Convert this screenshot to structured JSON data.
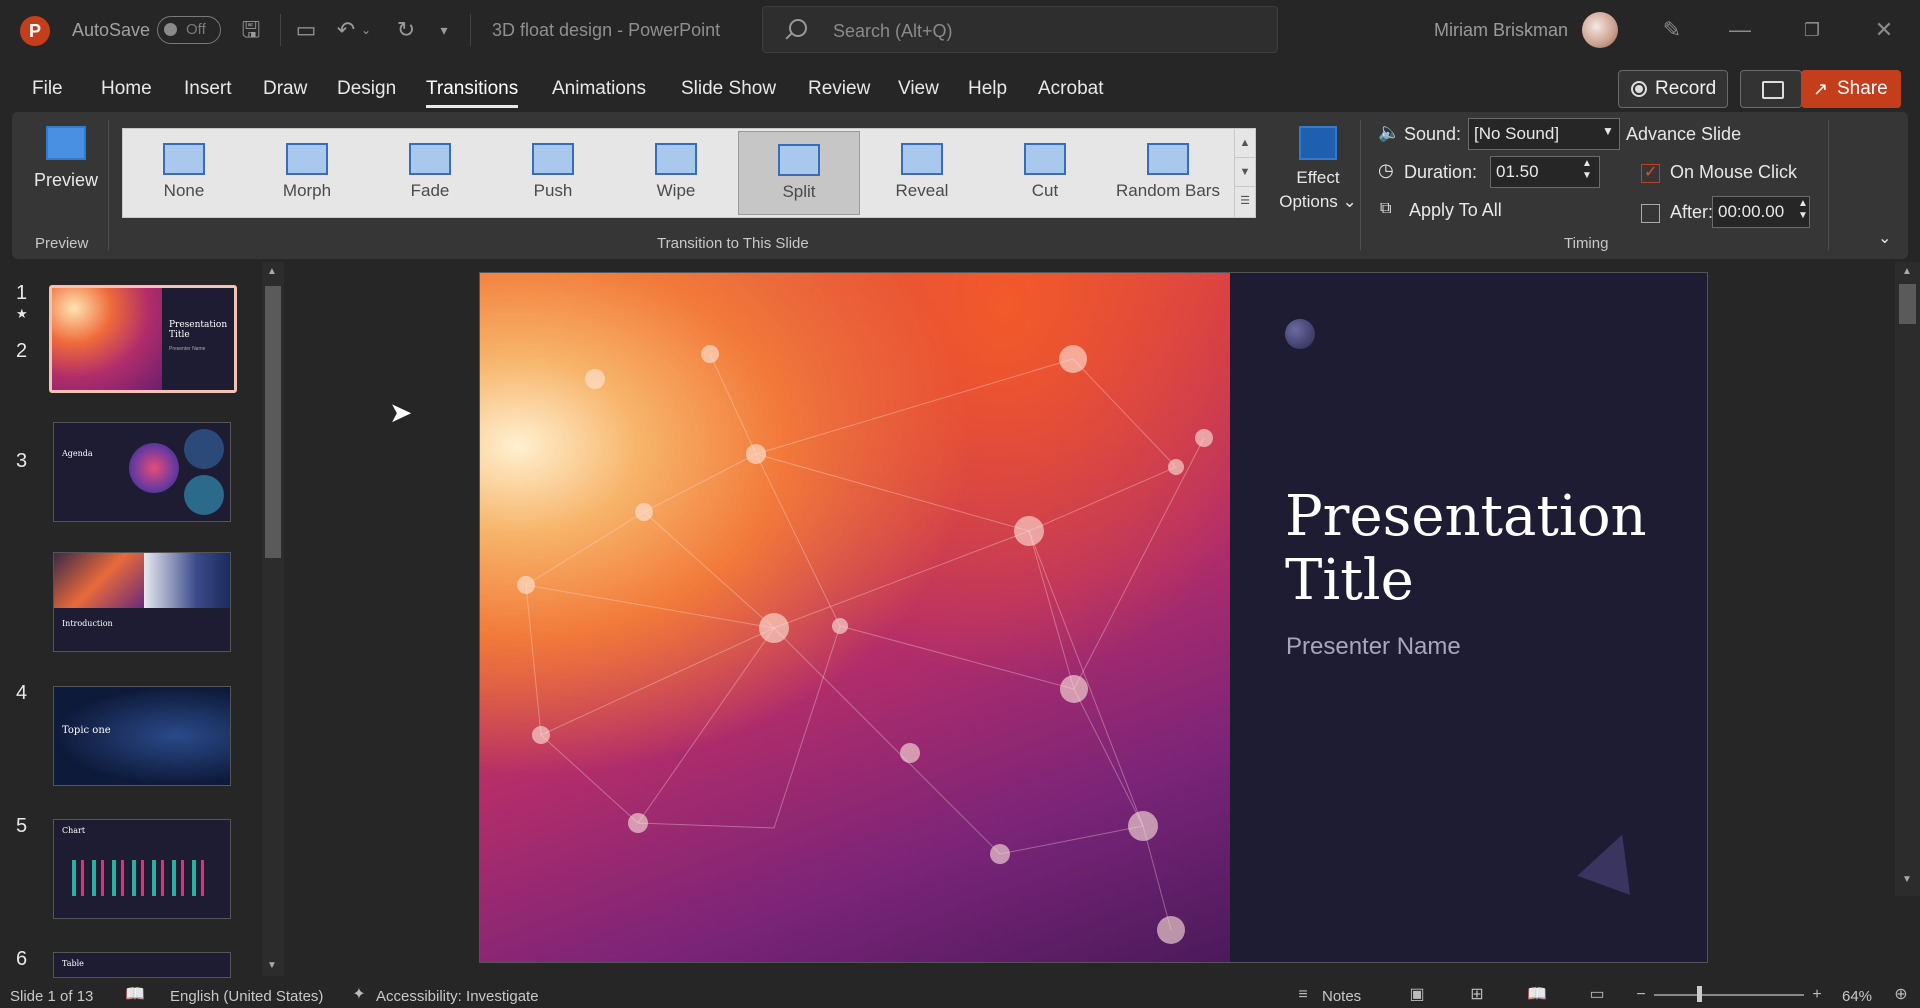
{
  "app": {
    "logo": "P",
    "autosave_label": "AutoSave",
    "autosave_state": "Off",
    "doc_title": "3D float design  -  PowerPoint",
    "search_placeholder": "Search (Alt+Q)",
    "user_name": "Miriam Briskman"
  },
  "menu": {
    "items": [
      "File",
      "Home",
      "Insert",
      "Draw",
      "Design",
      "Transitions",
      "Animations",
      "Slide Show",
      "Review",
      "View",
      "Help",
      "Acrobat"
    ],
    "active": "Transitions"
  },
  "header_buttons": {
    "record": "Record",
    "share": "Share"
  },
  "ribbon": {
    "preview_label": "Preview",
    "preview_group": "Preview",
    "transitions": [
      "None",
      "Morph",
      "Fade",
      "Push",
      "Wipe",
      "Split",
      "Reveal",
      "Cut",
      "Random Bars"
    ],
    "selected_transition": "Split",
    "transitions_group": "Transition to This Slide",
    "effect_options": [
      "Effect",
      "Options ⌄"
    ],
    "sound_label": "Sound:",
    "sound_value": "[No Sound]",
    "duration_label": "Duration:",
    "duration_value": "01.50",
    "apply_all": "Apply To All",
    "advance_title": "Advance Slide",
    "on_click_label": "On Mouse Click",
    "on_click_checked": true,
    "after_label": "After:",
    "after_value": "00:00.00",
    "after_checked": false,
    "timing_group": "Timing"
  },
  "slides": [
    {
      "num": "1",
      "title": "Presentation Title",
      "sub": "Presenter Name",
      "selected": true
    },
    {
      "num": "2",
      "title": "Agenda"
    },
    {
      "num": "3",
      "title": "Introduction"
    },
    {
      "num": "4",
      "title": "Topic one"
    },
    {
      "num": "5",
      "title": "Chart"
    },
    {
      "num": "6",
      "title": "Table"
    }
  ],
  "current_slide": {
    "title_line1": "Presentation",
    "title_line2": "Title",
    "subtitle": "Presenter Name"
  },
  "status": {
    "slide_info": "Slide 1 of 13",
    "language": "English (United States)",
    "accessibility": "Accessibility: Investigate",
    "notes": "Notes",
    "zoom": "64%"
  },
  "colors": {
    "accent": "#c43e1c",
    "ribbon_bg": "#363636",
    "app_bg": "#262626",
    "slide_dark": "#1e1c33"
  }
}
